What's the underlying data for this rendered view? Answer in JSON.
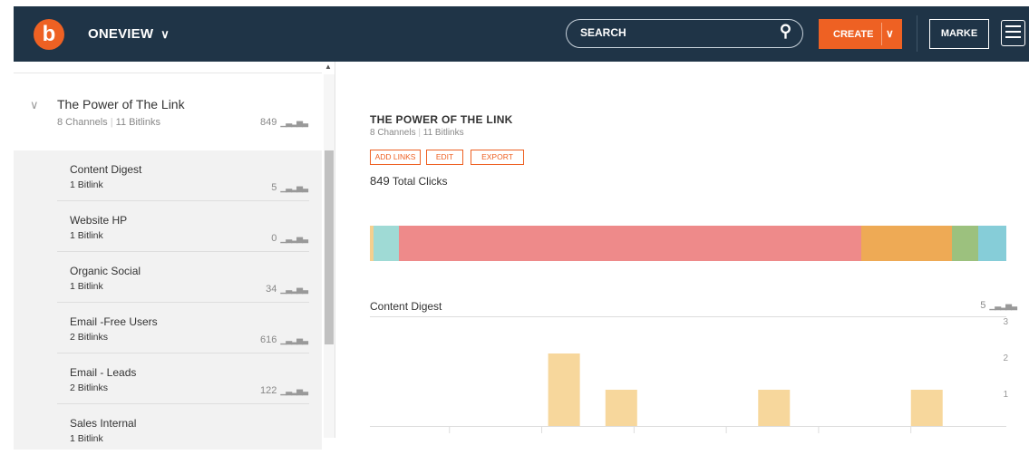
{
  "header": {
    "logo": "b",
    "workspace": "ONEVIEW",
    "search_placeholder": "SEARCH",
    "create_label": "CREATE",
    "account_label": "MARKE"
  },
  "sidebar": {
    "group": {
      "title": "The Power of The Link",
      "channels": "8 Channels",
      "bitlinks": "11 Bitlinks",
      "clicks": "849"
    },
    "channels": [
      {
        "name": "Content Digest",
        "count": "1 Bitlink",
        "clicks": "5"
      },
      {
        "name": "Website HP",
        "count": "1 Bitlink",
        "clicks": "0"
      },
      {
        "name": "Organic Social",
        "count": "1 Bitlink",
        "clicks": "34"
      },
      {
        "name": "Email -Free Users",
        "count": "2 Bitlinks",
        "clicks": "616"
      },
      {
        "name": "Email - Leads",
        "count": "2 Bitlinks",
        "clicks": "122"
      },
      {
        "name": "Sales Internal",
        "count": "1 Bitlink",
        "clicks": ""
      }
    ]
  },
  "main": {
    "title": "THE POWER OF THE LINK",
    "subtitle_channels": "8 Channels",
    "subtitle_bitlinks": "11 Bitlinks",
    "buttons": {
      "add_links": "ADD LINKS",
      "edit": "EDIT",
      "export": "EXPORT"
    },
    "total_clicks": "849",
    "total_clicks_label": "Total Clicks",
    "breakdown": {
      "segments": [
        {
          "clicks": 5,
          "color": "#f5cf8e"
        },
        {
          "clicks": 34,
          "color": "#9fdad5"
        },
        {
          "clicks": 616,
          "color": "#ee8a8a"
        },
        {
          "clicks": 122,
          "color": "#eeaa55"
        },
        {
          "clicks": 34,
          "color": "#9cc17e"
        },
        {
          "clicks": 38,
          "color": "#86cdd8"
        }
      ]
    },
    "channel_chart": {
      "label": "Content Digest",
      "clicks": "5"
    }
  },
  "chart_data": {
    "type": "bar",
    "title": "Content Digest",
    "values": [
      2,
      1,
      1,
      1
    ],
    "positions": [
      0.305,
      0.395,
      0.635,
      0.875
    ],
    "yticks": [
      1,
      2,
      3
    ],
    "ylim": [
      0,
      3
    ],
    "color": "#f7d79c"
  }
}
